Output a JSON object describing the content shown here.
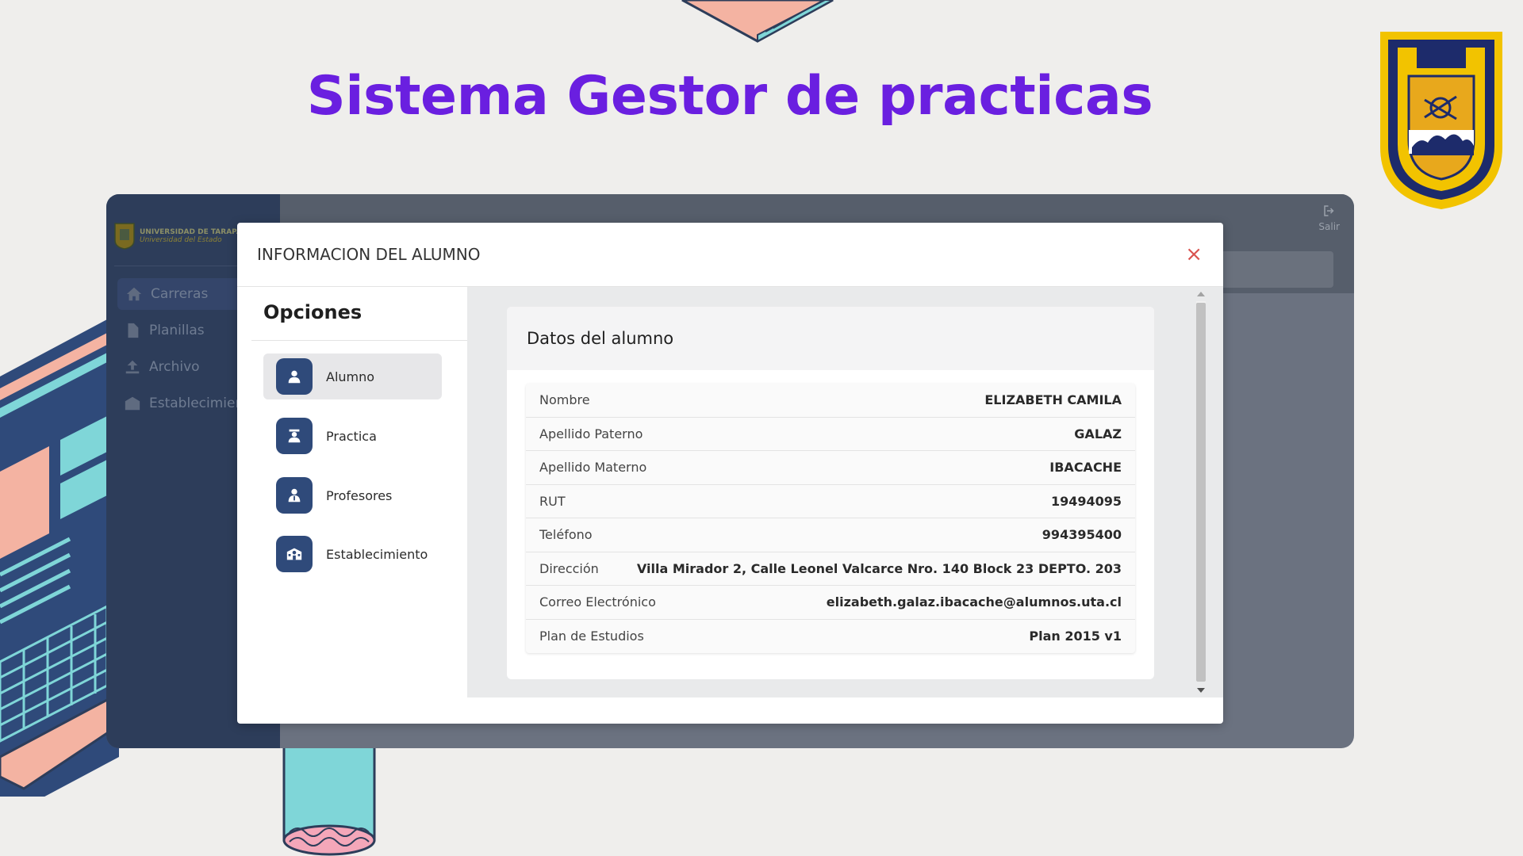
{
  "headline": "Sistema Gestor de practicas",
  "colors": {
    "headline": "#6a1fe0",
    "accent": "#2f4a7a",
    "close": "#d9534f"
  },
  "app": {
    "logo_line1": "UNIVERSIDAD DE TARAPACÁ",
    "logo_line2": "Universidad del Estado",
    "logout_label": "Salir",
    "nav": [
      {
        "label": "Carreras",
        "icon": "home-icon"
      },
      {
        "label": "Planillas",
        "icon": "document-icon"
      },
      {
        "label": "Archivo",
        "icon": "upload-icon"
      },
      {
        "label": "Establecimiento",
        "icon": "building-icon"
      }
    ]
  },
  "modal": {
    "title": "INFORMACION DEL ALUMNO",
    "close": "×",
    "options_title": "Opciones",
    "options": [
      {
        "label": "Alumno",
        "icon": "user-icon",
        "active": true
      },
      {
        "label": "Practica",
        "icon": "graduate-icon",
        "active": false
      },
      {
        "label": "Profesores",
        "icon": "teacher-icon",
        "active": false
      },
      {
        "label": "Establecimiento",
        "icon": "school-icon",
        "active": false
      }
    ],
    "card_title": "Datos del alumno",
    "fields": [
      {
        "label": "Nombre",
        "value": "ELIZABETH CAMILA"
      },
      {
        "label": "Apellido Paterno",
        "value": "GALAZ"
      },
      {
        "label": "Apellido Materno",
        "value": "IBACACHE"
      },
      {
        "label": "RUT",
        "value": "19494095"
      },
      {
        "label": "Teléfono",
        "value": "994395400"
      },
      {
        "label": "Dirección",
        "value": "Villa Mirador 2, Calle Leonel Valcarce Nro. 140 Block 23 DEPTO. 203"
      },
      {
        "label": "Correo Electrónico",
        "value": "elizabeth.galaz.ibacache@alumnos.uta.cl"
      },
      {
        "label": "Plan de Estudios",
        "value": "Plan 2015 v1"
      }
    ]
  }
}
